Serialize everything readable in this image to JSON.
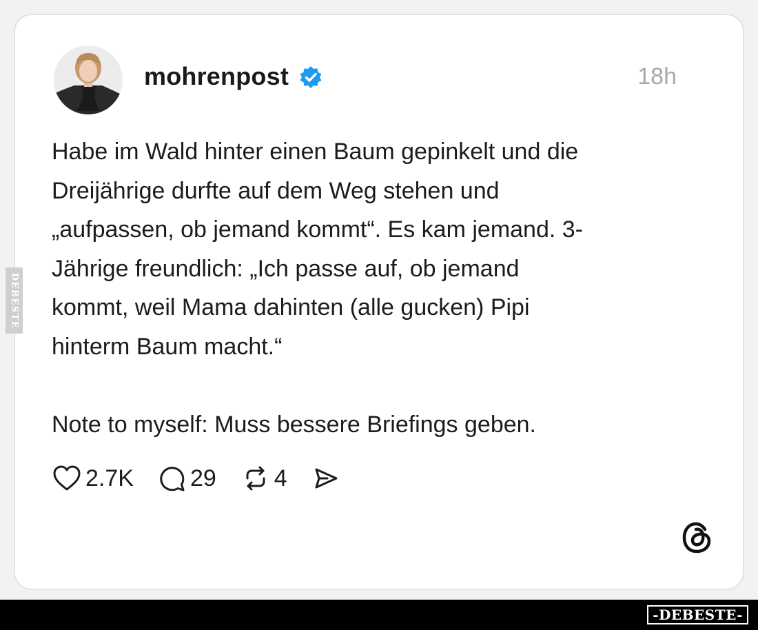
{
  "post": {
    "username": "mohrenpost",
    "verified_icon": "verified-badge-icon",
    "time": "18h",
    "text_lines": [
      "Habe im Wald hinter einen Baum gepinkelt und die",
      "Dreijährige durfte auf dem Weg stehen und",
      "„aufpassen, ob jemand kommt“. Es kam jemand. 3-",
      "Jährige freundlich: „Ich passe auf, ob jemand",
      "kommt, weil Mama dahinten (alle gucken) Pipi",
      "hinterm Baum macht.“"
    ],
    "note_line": "Note to myself: Muss bessere Briefings geben."
  },
  "actions": {
    "like_count": "2.7K",
    "comment_count": "29",
    "repost_count": "4",
    "icons": [
      "heart-icon",
      "comment-icon",
      "repost-icon",
      "share-icon"
    ]
  },
  "branding": {
    "side_watermark": "DEBESTE",
    "bottom_watermark": "-DEBESTE-",
    "threads_icon": "threads-logo-icon"
  },
  "colors": {
    "verified_blue": "#1d9bf0",
    "text": "#1c1c1c",
    "muted": "#a8a8a8",
    "card_border": "#e2e2e2"
  }
}
